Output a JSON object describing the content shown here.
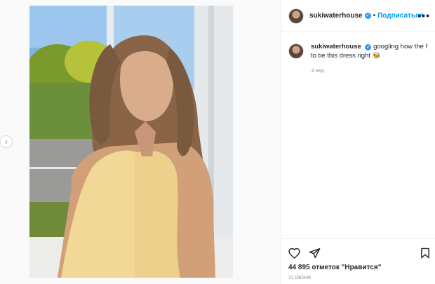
{
  "post": {
    "author": {
      "username": "sukiwaterhouse",
      "verified_mark": "✓",
      "separator": "•",
      "follow_label": "Подписаться",
      "more_label": "•••"
    },
    "caption": {
      "username": "sukiwaterhouse",
      "text": "googling how the f to tie this dress right 🐝",
      "time_ago": "4 нед."
    },
    "likes_text": "44 895 отметок \"Нравится\"",
    "date": "21 июня",
    "carousel": {
      "prev_label": "‹",
      "slide_count": 2,
      "active_slide": 1
    },
    "icons": {
      "like": "heart-icon",
      "share": "paper-plane-icon",
      "save": "bookmark-icon",
      "more": "more-options-icon",
      "verified": "verified-badge-icon"
    },
    "colors": {
      "accent": "#0095f6",
      "verified": "#3897f0",
      "text": "#262626",
      "muted": "#8e8e8e"
    }
  }
}
